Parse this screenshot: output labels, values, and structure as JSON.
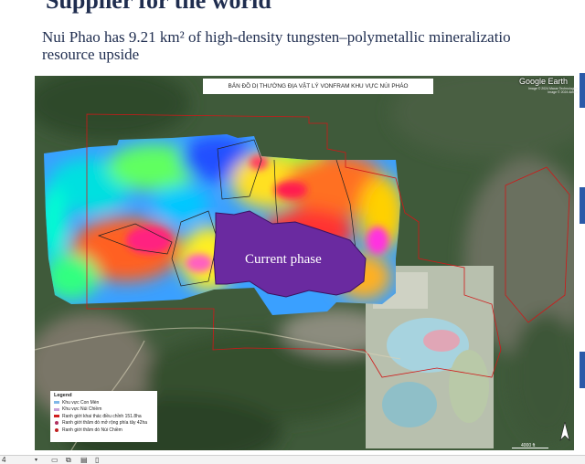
{
  "slide": {
    "heading": "Supplier for the world",
    "subtitle_line1": "Nui Phao has 9.21 km² of high-density tungsten–polymetallic mineralizatio",
    "subtitle_line2": "resource upside"
  },
  "map": {
    "title": "BẢN ĐỒ DỊ THƯỜNG ĐỊA VẬT LÝ VONFRAM KHU VỰC NÚI PHÁO",
    "logo": "Google Earth",
    "credit_line1": "Image © 2024 Maxar Technologies",
    "credit_line2": "Image © 2024 Airbus",
    "phase_label": "Current phase",
    "scale_label": "4000 ft",
    "legend": {
      "title": "Legend",
      "items": [
        {
          "label": "Khu vực Con Mèn",
          "color": "#7fb7e8",
          "kind": "line"
        },
        {
          "label": "Khu vực Núi Chiềm",
          "color": "#c8a0d8",
          "kind": "line"
        },
        {
          "label": "Ranh giới khai thác điều chỉnh 151.8ha",
          "color": "#d02020",
          "kind": "line"
        },
        {
          "label": "Ranh giới thăm dò mở rộng phía tây 42ha",
          "color": "#b03060",
          "kind": "dot"
        },
        {
          "label": "Ranh giới thăm dò Núi Chiềm",
          "color": "#c02020",
          "kind": "dot"
        }
      ]
    }
  },
  "toolbar": {
    "zoom_value": "4",
    "icons": [
      "dropdown-icon",
      "sheet-icon",
      "copy-icon",
      "layout-icon",
      "page-icon"
    ]
  },
  "colors": {
    "heading": "#1f2d4f",
    "phase_fill": "#6a2aa0",
    "boundary": "#d01818",
    "side_accent": "#2b5aa8"
  }
}
